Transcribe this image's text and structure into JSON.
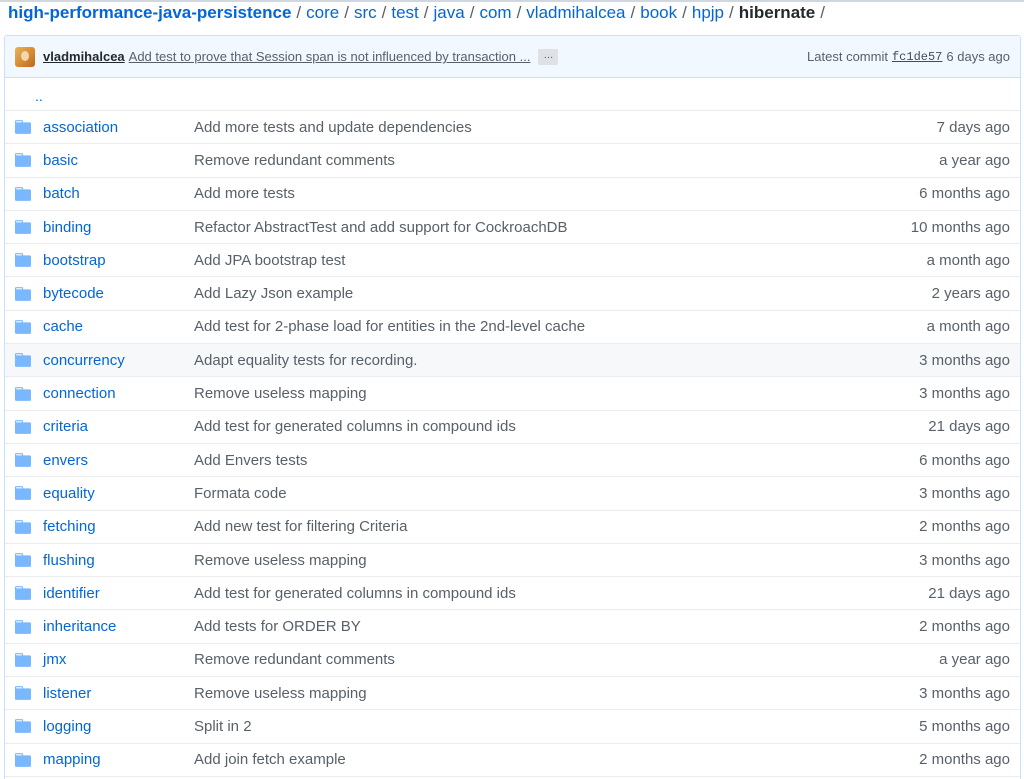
{
  "breadcrumb": {
    "repo": "high-performance-java-persistence",
    "parts": [
      "core",
      "src",
      "test",
      "java",
      "com",
      "vladmihalcea",
      "book",
      "hpjp"
    ],
    "current": "hibernate",
    "sep": "/"
  },
  "commit": {
    "author": "vladmihalcea",
    "message": "Add test to prove that Session span is not influenced by transaction ...",
    "ellipsis": "…",
    "latest_label": "Latest commit",
    "sha": "fc1de57",
    "age": "6 days ago"
  },
  "parent_link": "..",
  "colors": {
    "link": "#0366d6",
    "folder": "#79b8ff",
    "header_bg": "#f1f8ff",
    "border": "#c8e1ff"
  },
  "icons": {
    "folder": "folder-icon"
  },
  "files": [
    {
      "name": "association",
      "message": "Add more tests and update dependencies",
      "age": "7 days ago"
    },
    {
      "name": "basic",
      "message": "Remove redundant comments",
      "age": "a year ago"
    },
    {
      "name": "batch",
      "message": "Add more tests",
      "age": "6 months ago"
    },
    {
      "name": "binding",
      "message": "Refactor AbstractTest and add support for CockroachDB",
      "age": "10 months ago"
    },
    {
      "name": "bootstrap",
      "message": "Add JPA bootstrap test",
      "age": "a month ago"
    },
    {
      "name": "bytecode",
      "message": "Add Lazy Json example",
      "age": "2 years ago"
    },
    {
      "name": "cache",
      "message": "Add test for 2-phase load for entities in the 2nd-level cache",
      "age": "a month ago"
    },
    {
      "name": "concurrency",
      "message": "Adapt equality tests for recording.",
      "age": "3 months ago",
      "highlight": true
    },
    {
      "name": "connection",
      "message": "Remove useless mapping",
      "age": "3 months ago"
    },
    {
      "name": "criteria",
      "message": "Add test for generated columns in compound ids",
      "age": "21 days ago"
    },
    {
      "name": "envers",
      "message": "Add Envers tests",
      "age": "6 months ago"
    },
    {
      "name": "equality",
      "message": "Formata code",
      "age": "3 months ago"
    },
    {
      "name": "fetching",
      "message": "Add new test for filtering Criteria",
      "age": "2 months ago"
    },
    {
      "name": "flushing",
      "message": "Remove useless mapping",
      "age": "3 months ago"
    },
    {
      "name": "identifier",
      "message": "Add test for generated columns in compound ids",
      "age": "21 days ago"
    },
    {
      "name": "inheritance",
      "message": "Add tests for ORDER BY",
      "age": "2 months ago"
    },
    {
      "name": "jmx",
      "message": "Remove redundant comments",
      "age": "a year ago"
    },
    {
      "name": "listener",
      "message": "Remove useless mapping",
      "age": "3 months ago"
    },
    {
      "name": "logging",
      "message": "Split in 2",
      "age": "5 months ago"
    },
    {
      "name": "mapping",
      "message": "Add join fetch example",
      "age": "2 months ago"
    }
  ]
}
